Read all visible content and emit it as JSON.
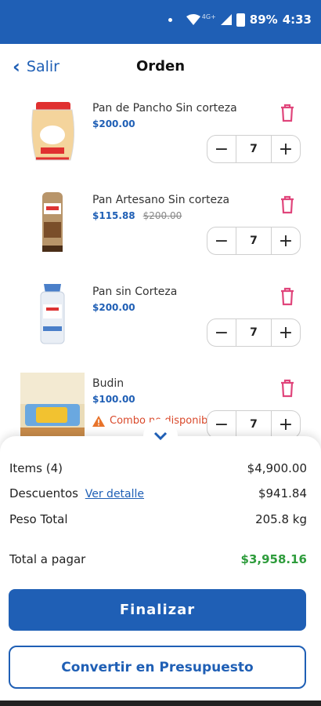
{
  "status_bar": {
    "network": "4G+",
    "battery": "89%",
    "time": "4:33"
  },
  "header": {
    "back_label": "Salir",
    "title": "Orden"
  },
  "items": [
    {
      "name": "Pan de Pancho Sin corteza",
      "price": "$200.00",
      "old_price": "",
      "quantity": "7"
    },
    {
      "name": "Pan Artesano Sin corteza",
      "price": "$115.88",
      "old_price": "$200.00",
      "quantity": "7"
    },
    {
      "name": "Pan sin Corteza",
      "price": "$200.00",
      "old_price": "",
      "quantity": "7"
    },
    {
      "name": "Budin",
      "price": "$100.00",
      "old_price": "",
      "quantity": "7",
      "warning": "Combo no disponible"
    }
  ],
  "summary": {
    "items_label": "Items (4)",
    "items_value": "$4,900.00",
    "discounts_label": "Descuentos",
    "discounts_link": "Ver detalle",
    "discounts_value": "$941.84",
    "weight_label": "Peso Total",
    "weight_value": "205.8 kg",
    "total_label": "Total a pagar",
    "total_value": "$3,958.16"
  },
  "buttons": {
    "finalize": "Finalizar",
    "convert": "Convertir en Presupuesto"
  },
  "colors": {
    "primary": "#1f5fb5",
    "trash": "#e0457b",
    "total": "#2e9c3c",
    "warning": "#d9492b"
  }
}
